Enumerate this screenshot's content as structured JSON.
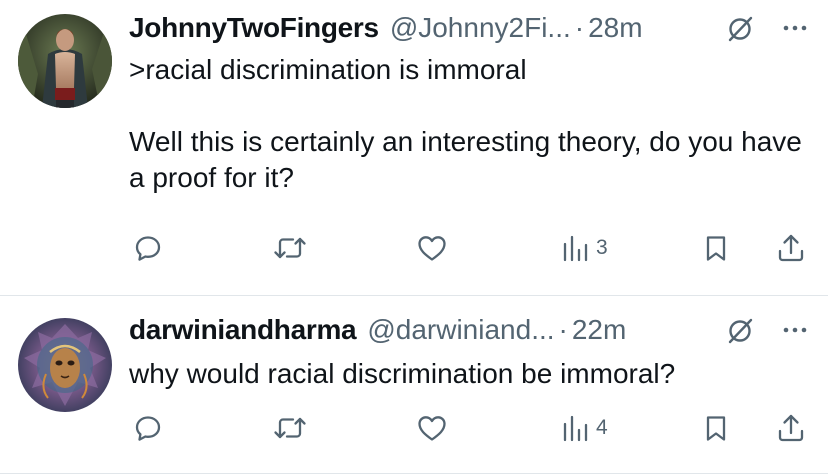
{
  "tweets": [
    {
      "display_name": "JohnnyTwoFingers",
      "handle": "@Johnny2Fi...",
      "separator": "·",
      "time": "28m",
      "text": ">racial discrimination is immoral\n\nWell this is certainly an interesting theory, do you have a proof for it?",
      "views": "3",
      "icons": [
        "reply-icon",
        "repost-icon",
        "like-icon",
        "views-icon",
        "bookmark-icon",
        "share-icon",
        "mute-icon",
        "more-icon"
      ]
    },
    {
      "display_name": "darwiniandharma",
      "handle": "@darwiniand...",
      "separator": "·",
      "time": "22m",
      "text": "why would racial discrimination be immoral?",
      "views": "4",
      "icons": [
        "reply-icon",
        "repost-icon",
        "like-icon",
        "views-icon",
        "bookmark-icon",
        "share-icon",
        "mute-icon",
        "more-icon"
      ]
    }
  ],
  "colors": {
    "text": "#0f1419",
    "secondary": "#536471",
    "divider": "#e1e6ea",
    "background": "#ffffff"
  }
}
